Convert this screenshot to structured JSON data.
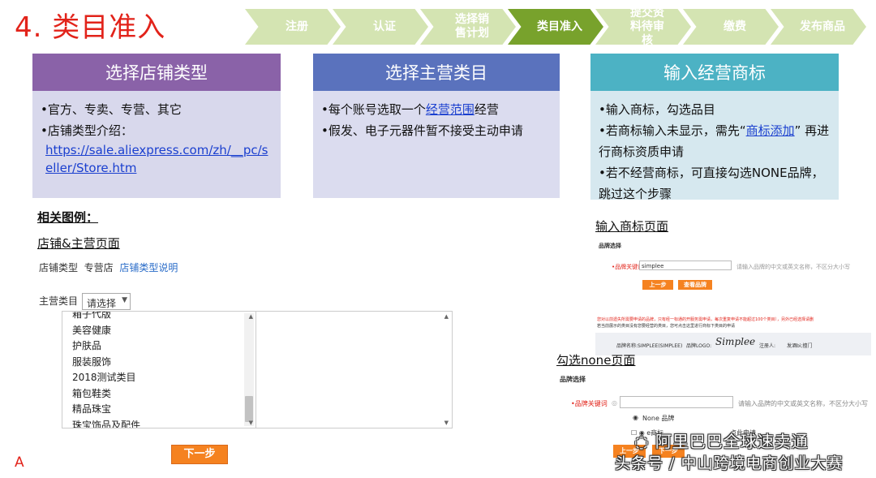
{
  "page_title": "4. 类目准入",
  "steps": [
    {
      "label": "注册",
      "active": false
    },
    {
      "label": "认证",
      "active": false
    },
    {
      "label": "选择销售计划",
      "active": false
    },
    {
      "label": "类目准入",
      "active": true
    },
    {
      "label": "提交资料待审核",
      "active": false
    },
    {
      "label": "缴费",
      "active": false
    },
    {
      "label": "发布商品",
      "active": false
    }
  ],
  "cards": [
    {
      "title": "选择店铺类型",
      "line1": "•官方、专卖、专营、其它",
      "line2": "•店铺类型介绍：",
      "link": "https://sale.aliexpress.com/zh/__pc/seller/Store.htm"
    },
    {
      "title": "选择主营类目",
      "line1_prefix": "•每个账号选取一个",
      "line1_link": "经营范围",
      "line1_suffix": "经营",
      "line2": "•假发、电子元器件暂不接受主动申请"
    },
    {
      "title": "输入经营商标",
      "line1": "•输入商标，勾选品目",
      "line2_prefix": "•若商标输入未显示，需先“",
      "line2_link": "商标添加",
      "line2_suffix": "” 再进行商标资质申请",
      "line3": "•若不经营商标，可直接勾选NONE品牌，跳过这个步骤"
    }
  ],
  "examples": {
    "heading": "相关图例：",
    "store_label": "店铺&主营页面",
    "store_type_label": "店铺类型",
    "store_type_value": "专营店",
    "store_type_link": "店铺类型说明",
    "main_category_label": "主营类目",
    "select_value": "请选择",
    "category_items": [
      "箱子代版",
      "美容健康",
      "护肤品",
      "服装服饰",
      "2018测试类目",
      "箱包鞋类",
      "精品珠宝",
      "珠宝饰品及配件"
    ],
    "next_button": "下一步",
    "corner_letter": "A"
  },
  "brand_page": {
    "label": "输入商标页面",
    "section_title": "品牌选择",
    "keyword_label": "•品牌关键词",
    "keyword_value": "simplee",
    "keyword_hint": "请输入品牌的中文或英文名称，不区分大小写",
    "prev_button": "上一步",
    "view_button": "查看品牌",
    "notice_red": "您对以前遗失所需要申请的品牌，只有经一标通的开服务需申请，每次重复申请不能超过100个类目），另外已经选择请删",
    "notice_gray": "若当前展示的类目没有您要经营的类目，您可点击这里进行商标下类目的申请",
    "brand_name": "品牌名称:SIMPLEE(SIMPLEE)",
    "brand_logo_label": "品牌LOGO:",
    "brand_logo_text": "Simplee",
    "registrant": "注册人:",
    "registrant_value": "发酒bi;擅门"
  },
  "none_page": {
    "label": "勾选none页面",
    "section_title": "品牌选择",
    "keyword_label": "•品牌关键词",
    "keyword_hint": "请输入品牌的中文或英文名称，不区分大小写",
    "none_option": "None 品牌",
    "apply_line_prefix": "e商标",
    "apply_line_link": "点此申请",
    "prev_button": "上一步",
    "next_button": "下一步"
  },
  "watermark": {
    "line1": "阿里巴巴全球速卖通",
    "line2": "头条号 / 中山跨境电商创业大赛"
  }
}
